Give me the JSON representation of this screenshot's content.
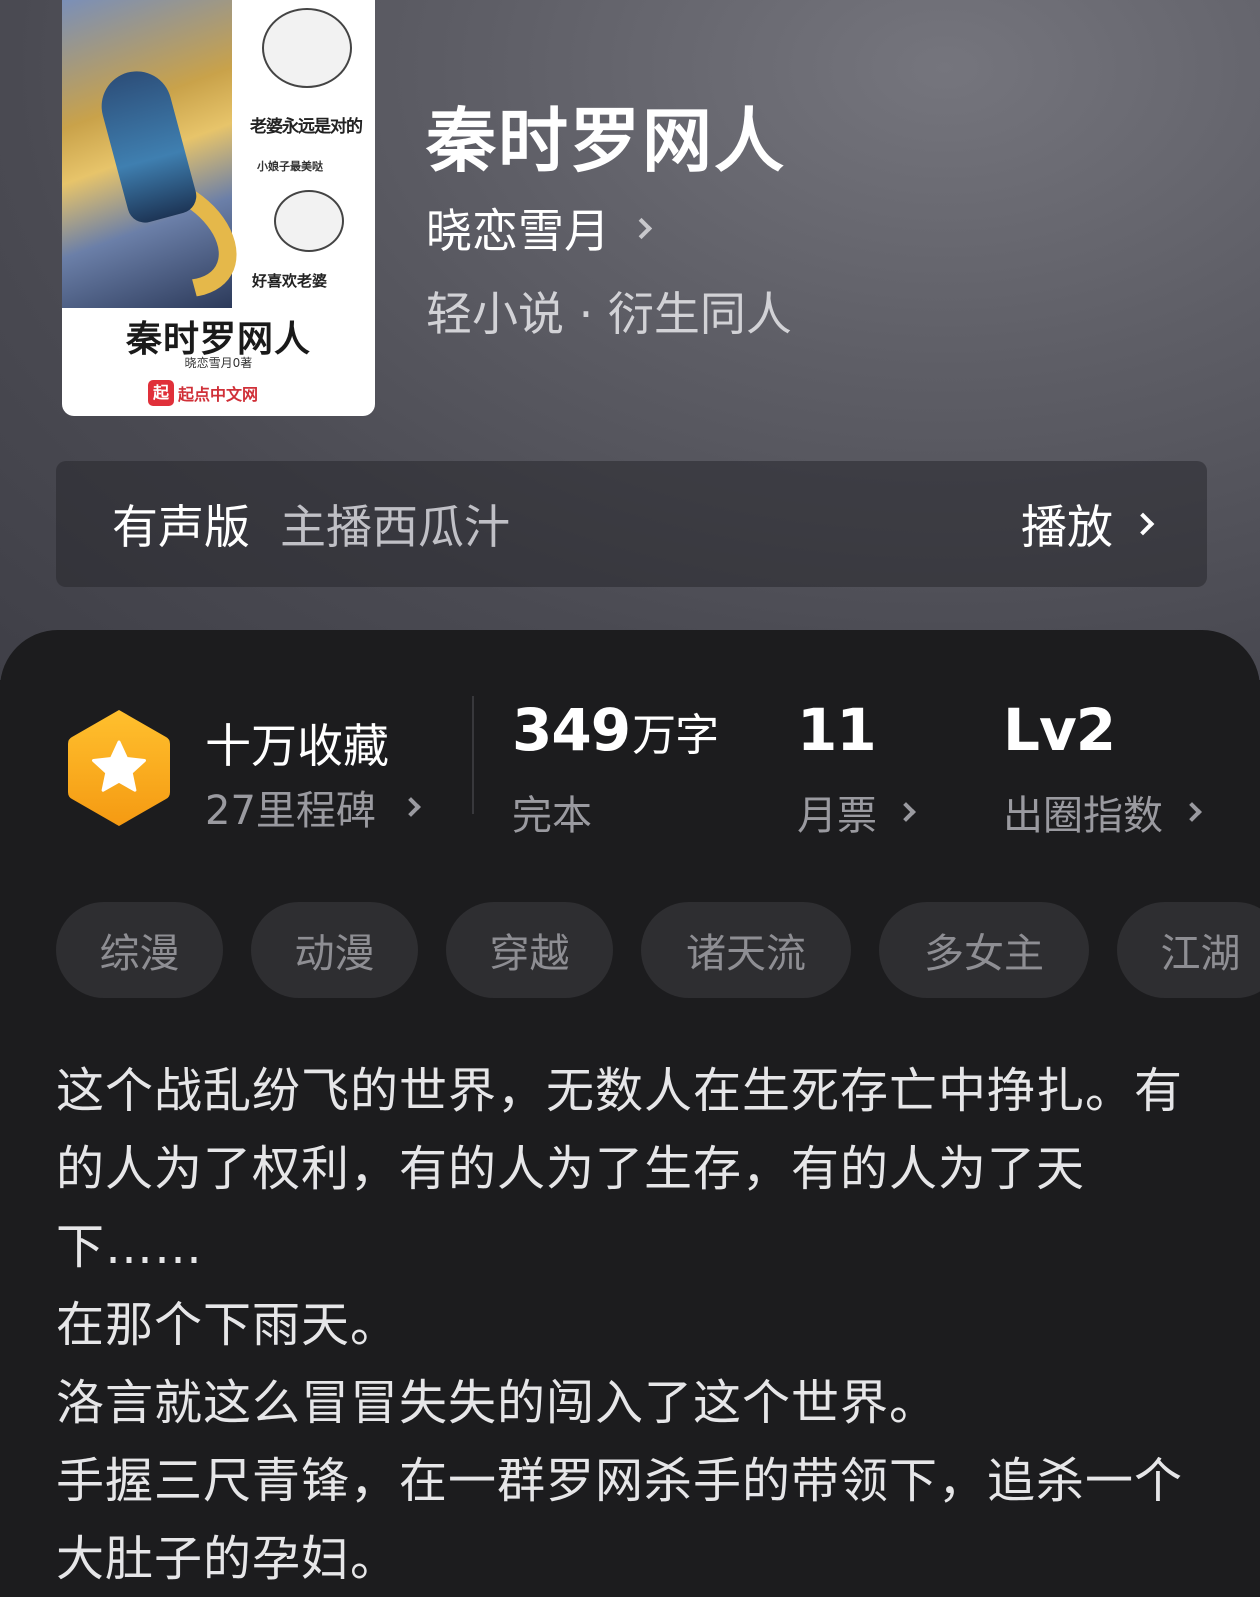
{
  "book": {
    "title": "秦时罗网人",
    "author": "晓恋雪月",
    "category": "轻小说 · 衍生同人"
  },
  "cover": {
    "slogan": "老婆永远是对的",
    "small_text_1": "小娘子最美哒",
    "small_text_2": "好喜欢老婆",
    "title": "秦时罗网人",
    "author": "晓恋雪月0著",
    "logo_mark": "起",
    "logo_text": "起点中文网"
  },
  "audio": {
    "label": "有声版",
    "narrator": "主播西瓜汁",
    "play_label": "播放"
  },
  "milestone": {
    "title": "十万收藏",
    "subtitle": "27里程碑"
  },
  "stats": {
    "words_value": "349",
    "words_unit": "万字",
    "words_label": "完本",
    "tickets_value": "11",
    "tickets_label": "月票",
    "level_value": "Lv2",
    "level_label": "出圈指数"
  },
  "tags": [
    "综漫",
    "动漫",
    "穿越",
    "诸天流",
    "多女主",
    "江湖"
  ],
  "synopsis": [
    "这个战乱纷飞的世界，无数人在生死存亡中挣扎。有的人为了权利，有的人为了生存，有的人为了天下……",
    "在那个下雨天。",
    "洛言就这么冒冒失失的闯入了这个世界。",
    "手握三尺青锋，在一群罗网杀手的带领下，追杀一个大肚子的孕妇。"
  ],
  "colors": {
    "badge": "#f7a81b",
    "panel": "#1c1c1e",
    "tag_bg": "#2e2e31"
  }
}
